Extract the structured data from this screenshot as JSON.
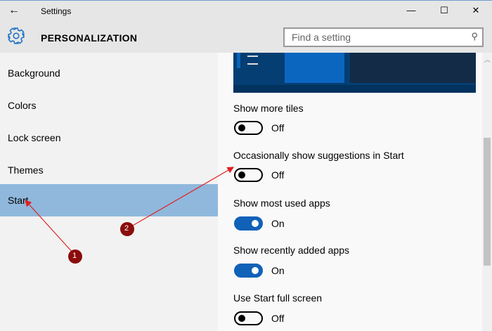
{
  "window": {
    "title": "Settings",
    "back": "←",
    "minimize": "—",
    "maximize": "☐",
    "close": "✕"
  },
  "header": {
    "title": "PERSONALIZATION",
    "search_placeholder": "Find a setting"
  },
  "sidebar": {
    "items": [
      {
        "label": "Background"
      },
      {
        "label": "Colors"
      },
      {
        "label": "Lock screen"
      },
      {
        "label": "Themes"
      },
      {
        "label": "Start",
        "selected": true
      }
    ]
  },
  "settings": [
    {
      "label": "Show more tiles",
      "state": "Off",
      "on": false
    },
    {
      "label": "Occasionally show suggestions in Start",
      "state": "Off",
      "on": false
    },
    {
      "label": "Show most used apps",
      "state": "On",
      "on": true
    },
    {
      "label": "Show recently added apps",
      "state": "On",
      "on": true
    },
    {
      "label": "Use Start full screen",
      "state": "Off",
      "on": false
    }
  ],
  "annotations": [
    "1",
    "2"
  ],
  "colors": {
    "accent": "#1061b8",
    "selected": "#8fb8dc",
    "annotation": "#8b0c0c"
  }
}
